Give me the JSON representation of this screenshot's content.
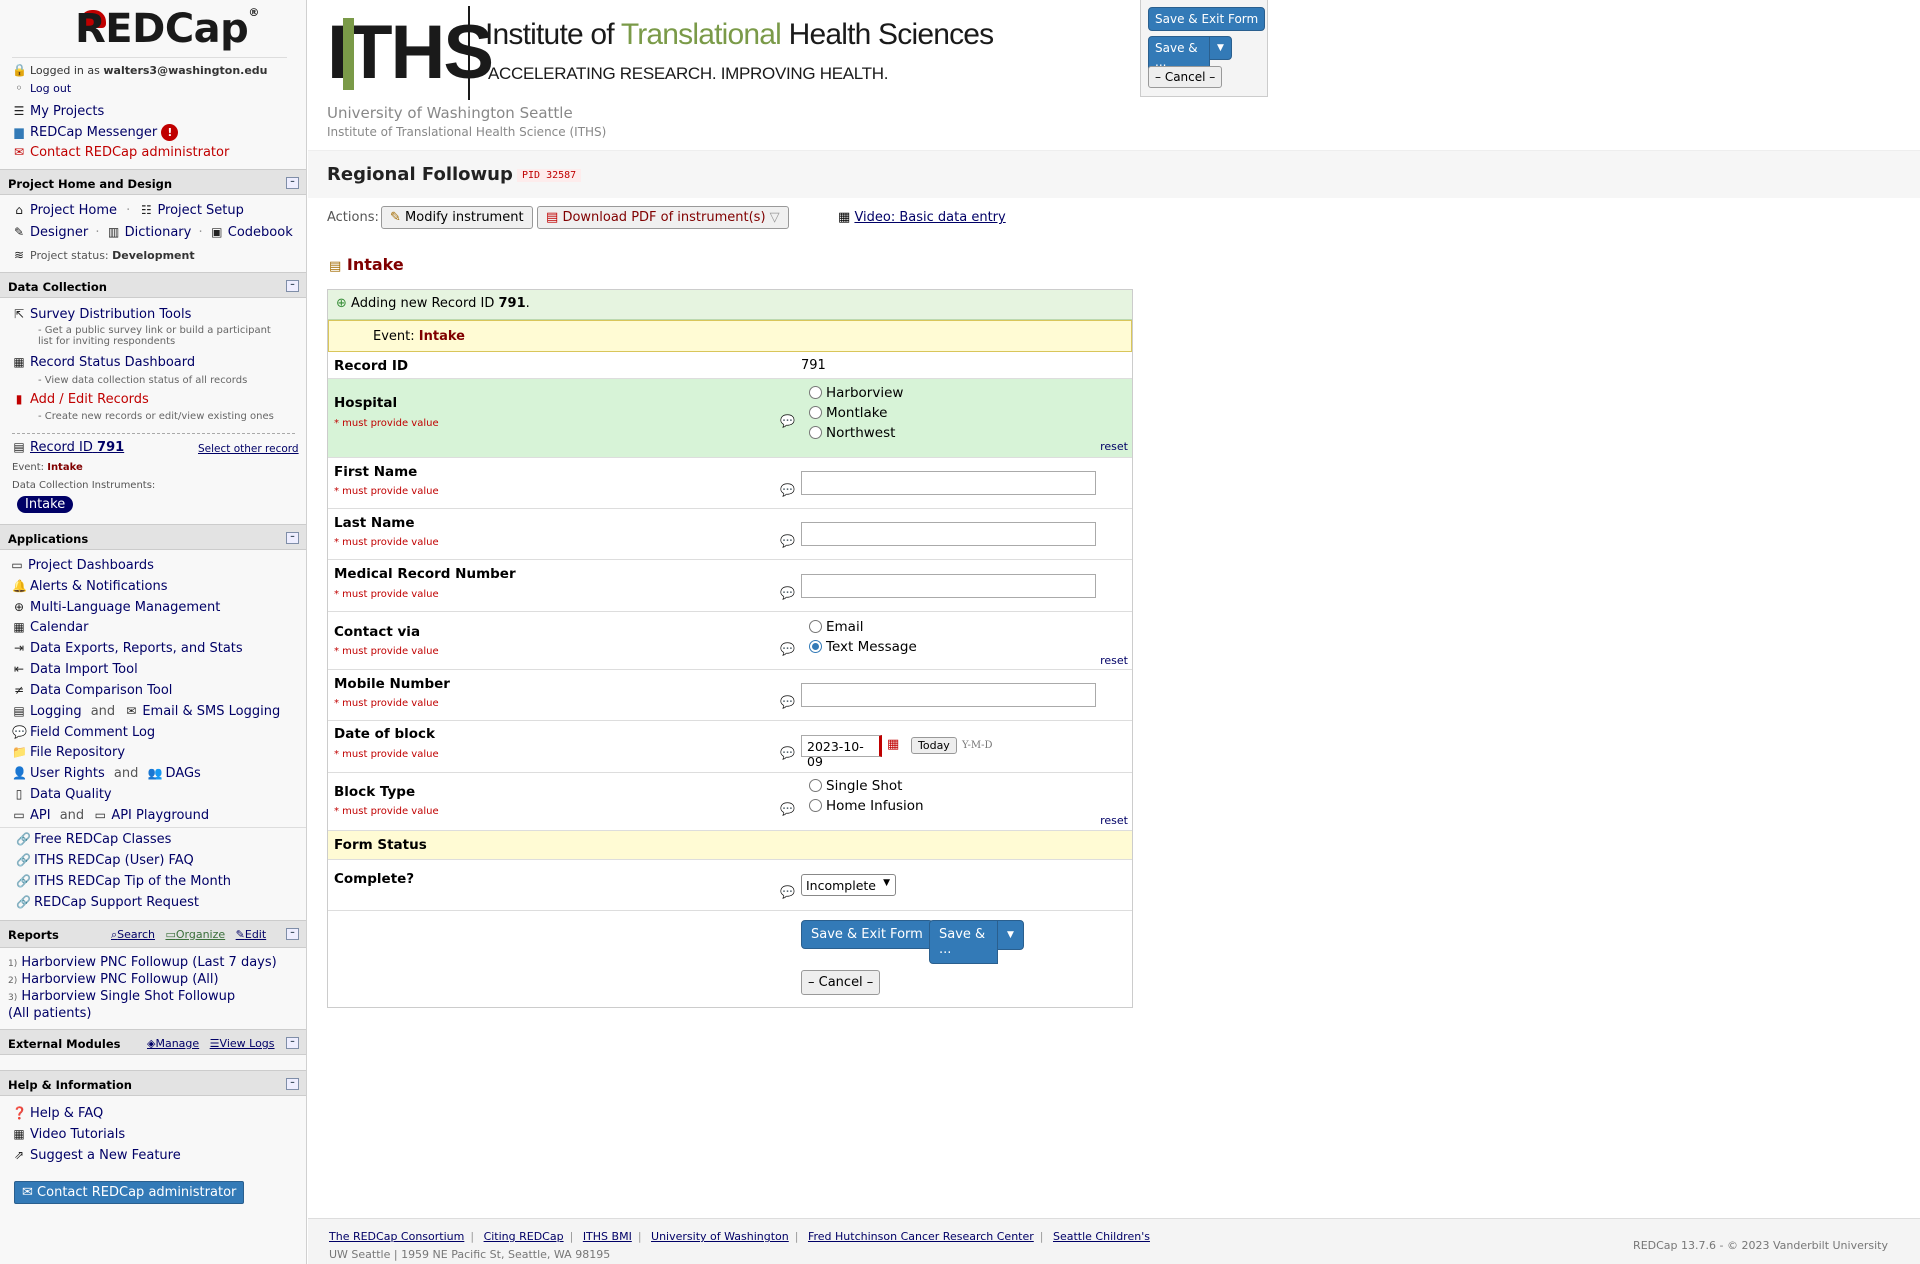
{
  "sidebar": {
    "logo": "REDCap",
    "logo_mark": "®",
    "logged_in_prefix": "Logged in as",
    "user": "walters3@washington.edu",
    "logout": "Log out",
    "my_projects": "My Projects",
    "messenger": "REDCap Messenger",
    "messenger_badge": "!",
    "contact_admin": "Contact REDCap administrator",
    "sections": {
      "project_home": "Project Home and Design",
      "data_collection": "Data Collection",
      "applications": "Applications",
      "reports": "Reports",
      "external_modules": "External Modules",
      "help": "Help & Information"
    },
    "project_home": {
      "home": "Project Home",
      "setup": "Project Setup",
      "designer": "Designer",
      "dictionary": "Dictionary",
      "codebook": "Codebook",
      "status_label": "Project status:",
      "status": "Development"
    },
    "data_collection": {
      "survey_tools": "Survey Distribution Tools",
      "survey_desc": "- Get a public survey link or build a participant list for inviting respondents",
      "record_status": "Record Status Dashboard",
      "record_status_desc": "- View data collection status of all records",
      "add_edit": "Add / Edit Records",
      "add_edit_desc": "- Create new records or edit/view existing ones",
      "record_label": "Record ID",
      "record_id": "791",
      "select_other": "Select other record",
      "event_label": "Event:",
      "event": "Intake",
      "instruments_label": "Data Collection Instruments:",
      "instrument": "Intake"
    },
    "applications": [
      "Project Dashboards",
      "Alerts & Notifications",
      "Multi-Language Management",
      "Calendar",
      "Data Exports, Reports, and Stats",
      "Data Import Tool",
      "Data Comparison Tool",
      "Logging",
      "Email & SMS Logging",
      "Field Comment Log",
      "File Repository",
      "User Rights",
      "DAGs",
      "Data Quality",
      "API",
      "API Playground"
    ],
    "and": "and",
    "links": [
      "Free REDCap Classes",
      "ITHS REDCap (User) FAQ",
      "ITHS REDCap Tip of the Month",
      "REDCap Support Request"
    ],
    "reports_tools": {
      "search": "Search",
      "organize": "Organize",
      "edit": "Edit"
    },
    "reports": [
      {
        "n": "1)",
        "label": "Harborview PNC Followup (Last 7 days)"
      },
      {
        "n": "2)",
        "label": "Harborview PNC Followup (All)"
      },
      {
        "n": "3)",
        "label": "Harborview Single Shot Followup (All patients)"
      }
    ],
    "modules_tools": {
      "manage": "Manage",
      "view_logs": "View Logs"
    },
    "help": [
      "Help & FAQ",
      "Video Tutorials",
      "Suggest a New Feature"
    ],
    "contact_button": "Contact REDCap administrator"
  },
  "header": {
    "iths_letters": "ITHS",
    "iths_title_a": "Institute of ",
    "iths_title_b": "Translational",
    "iths_title_c": " Health Sciences",
    "iths_tagline": "ACCELERATING RESEARCH. IMPROVING HEALTH.",
    "org": "University of Washington Seattle",
    "org_sub": "Institute of Translational Health Science (ITHS)",
    "project_title": "Regional Followup",
    "pid": "PID 32587"
  },
  "floating": {
    "save_exit": "Save & Exit Form",
    "save_more": "Save & ...",
    "cancel": "– Cancel –"
  },
  "actions": {
    "label": "Actions:",
    "modify": "Modify instrument",
    "download": "Download PDF of instrument(s)",
    "video": "Video: Basic data entry"
  },
  "form": {
    "instrument_title": "Intake",
    "notice_prefix": "Adding new Record ID",
    "notice_id": "791",
    "event_label": "Event:",
    "event": "Intake",
    "must": "* must provide value",
    "reset": "reset",
    "record_id_label": "Record ID",
    "record_id_value": "791",
    "hospital_label": "Hospital",
    "hospital_options": [
      "Harborview",
      "Montlake",
      "Northwest"
    ],
    "first_name": "First Name",
    "last_name": "Last Name",
    "mrn": "Medical Record Number",
    "contact_label": "Contact via",
    "contact_options": [
      "Email",
      "Text Message"
    ],
    "contact_selected": "Text Message",
    "mobile": "Mobile Number",
    "date_label": "Date of block",
    "date_value": "2023-10-09",
    "today": "Today",
    "date_format": "Y-M-D",
    "block_label": "Block Type",
    "block_options": [
      "Single Shot",
      "Home Infusion"
    ],
    "status_header": "Form Status",
    "complete_label": "Complete?",
    "complete_value": "Incomplete",
    "save_exit": "Save & Exit Form",
    "save_more": "Save & ...",
    "cancel": "– Cancel –"
  },
  "footer": {
    "links": [
      "The REDCap Consortium",
      "Citing REDCap",
      "ITHS BMI",
      "University of Washington",
      "Fred Hutchinson Cancer Research Center",
      "Seattle Children's"
    ],
    "address": "UW Seattle | 1959 NE Pacific St, Seattle, WA 98195",
    "version": "REDCap 13.7.6 - © 2023 Vanderbilt University"
  },
  "colors": {
    "accent": "#337ab7",
    "redcap_red": "#c00000",
    "nav": "#000066",
    "required_bg": "#d7f3d7",
    "notice_bg": "#fffbd4"
  }
}
